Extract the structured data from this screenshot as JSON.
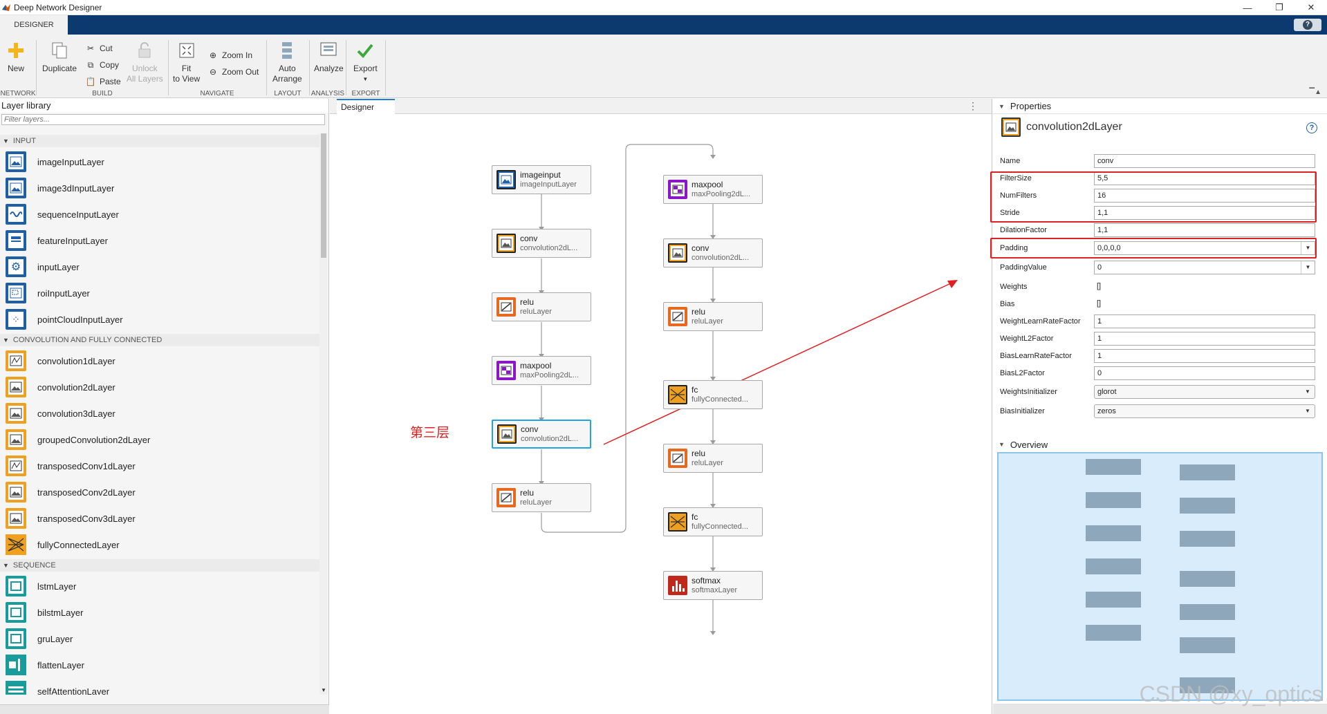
{
  "window": {
    "title": "Deep Network Designer",
    "controls": [
      "—",
      "❐",
      "✕"
    ]
  },
  "tab": {
    "label": "DESIGNER"
  },
  "ribbon": {
    "new": "New",
    "duplicate": "Duplicate",
    "cut": "Cut",
    "copy": "Copy",
    "paste": "Paste",
    "unlock": "Unlock",
    "all_layers": "All Layers",
    "fit": "Fit",
    "to_view": "to View",
    "zoom_in": "Zoom In",
    "zoom_out": "Zoom Out",
    "auto": "Auto",
    "arrange": "Arrange",
    "analyze": "Analyze",
    "export": "Export",
    "sections": {
      "network": "NETWORK",
      "build": "BUILD",
      "navigate": "NAVIGATE",
      "layout": "LAYOUT",
      "analysis": "ANALYSIS",
      "export": "EXPORT"
    }
  },
  "library": {
    "title": "Layer library",
    "filter_placeholder": "Filter layers...",
    "cat_input": "INPUT",
    "cat_conv": "CONVOLUTION AND FULLY CONNECTED",
    "cat_seq": "SEQUENCE",
    "input_items": [
      "imageInputLayer",
      "image3dInputLayer",
      "sequenceInputLayer",
      "featureInputLayer",
      "inputLayer",
      "roiInputLayer",
      "pointCloudInputLayer"
    ],
    "conv_items": [
      "convolution1dLayer",
      "convolution2dLayer",
      "convolution3dLayer",
      "groupedConvolution2dLayer",
      "transposedConv1dLayer",
      "transposedConv2dLayer",
      "transposedConv3dLayer",
      "fullyConnectedLayer"
    ],
    "seq_items": [
      "lstmLayer",
      "bilstmLayer",
      "gruLayer",
      "flattenLayer",
      "selfAttentionLayer"
    ]
  },
  "designer": {
    "tab": "Designer",
    "menu": "⋮",
    "annotation": "第三层",
    "nodes": [
      {
        "name": "imageinput",
        "type": "imageInputLayer"
      },
      {
        "name": "conv",
        "type": "convolution2dL..."
      },
      {
        "name": "relu",
        "type": "reluLayer"
      },
      {
        "name": "maxpool",
        "type": "maxPooling2dL..."
      },
      {
        "name": "conv",
        "type": "convolution2dL..."
      },
      {
        "name": "relu",
        "type": "reluLayer"
      },
      {
        "name": "maxpool",
        "type": "maxPooling2dL..."
      },
      {
        "name": "conv",
        "type": "convolution2dL..."
      },
      {
        "name": "relu",
        "type": "reluLayer"
      },
      {
        "name": "fc",
        "type": "fullyConnected..."
      },
      {
        "name": "relu",
        "type": "reluLayer"
      },
      {
        "name": "fc",
        "type": "fullyConnected..."
      },
      {
        "name": "softmax",
        "type": "softmaxLayer"
      }
    ]
  },
  "properties": {
    "header": "Properties",
    "layer": "convolution2dLayer",
    "help": "?",
    "rows": [
      {
        "label": "Name",
        "value": "conv"
      },
      {
        "label": "FilterSize",
        "value": "5,5"
      },
      {
        "label": "NumFilters",
        "value": "16"
      },
      {
        "label": "Stride",
        "value": "1,1"
      },
      {
        "label": "DilationFactor",
        "value": "1,1"
      },
      {
        "label": "Padding",
        "value": "0,0,0,0"
      },
      {
        "label": "PaddingValue",
        "value": "0"
      },
      {
        "label": "Weights",
        "value": "[]"
      },
      {
        "label": "Bias",
        "value": "[]"
      },
      {
        "label": "WeightLearnRateFactor",
        "value": "1"
      },
      {
        "label": "WeightL2Factor",
        "value": "1"
      },
      {
        "label": "BiasLearnRateFactor",
        "value": "1"
      },
      {
        "label": "BiasL2Factor",
        "value": "0"
      },
      {
        "label": "WeightsInitializer",
        "value": "glorot"
      },
      {
        "label": "BiasInitializer",
        "value": "zeros"
      }
    ]
  },
  "overview": {
    "header": "Overview"
  },
  "watermark": "CSDN @xy_optics",
  "colors": {
    "accent": "#0d3a6e",
    "selection": "#1fa3e6",
    "annotation": "#e02020",
    "input_icon": "#1f5fa8",
    "conv_icon": "#f0a020",
    "pool_icon": "#8a18c9",
    "seq_icon": "#179b9b",
    "softmax_icon": "#c0281c"
  }
}
